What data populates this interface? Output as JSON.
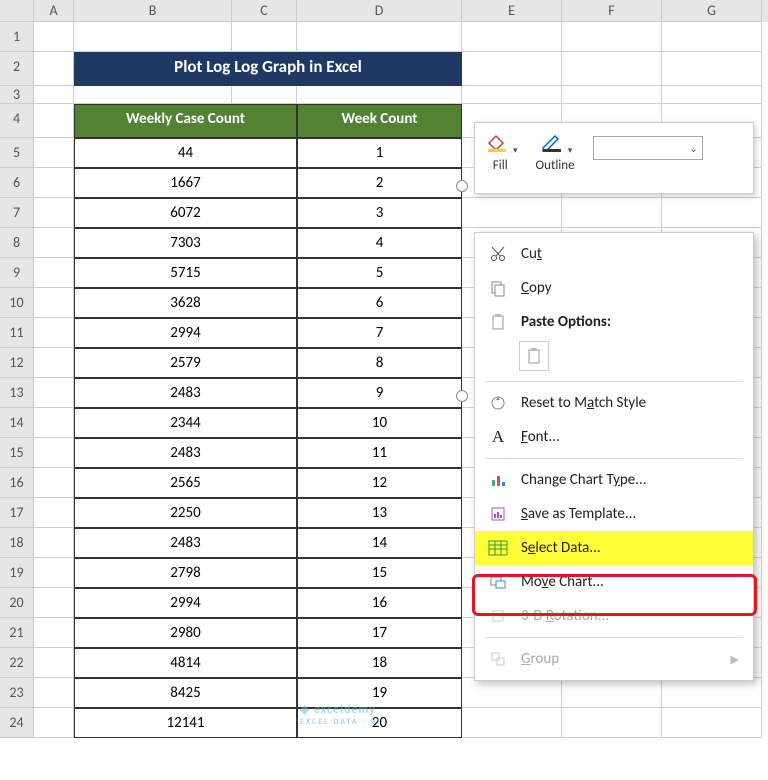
{
  "cols": [
    "A",
    "B",
    "C",
    "D",
    "E",
    "F",
    "G"
  ],
  "title": "Plot Log Log Graph in Excel",
  "headers": {
    "b": "Weekly Case Count",
    "d": "Week Count"
  },
  "rows": [
    {
      "b": "44",
      "d": "1"
    },
    {
      "b": "1667",
      "d": "2"
    },
    {
      "b": "6072",
      "d": "3"
    },
    {
      "b": "7303",
      "d": "4"
    },
    {
      "b": "5715",
      "d": "5"
    },
    {
      "b": "3628",
      "d": "6"
    },
    {
      "b": "2994",
      "d": "7"
    },
    {
      "b": "2579",
      "d": "8"
    },
    {
      "b": "2483",
      "d": "9"
    },
    {
      "b": "2344",
      "d": "10"
    },
    {
      "b": "2483",
      "d": "11"
    },
    {
      "b": "2565",
      "d": "12"
    },
    {
      "b": "2250",
      "d": "13"
    },
    {
      "b": "2483",
      "d": "14"
    },
    {
      "b": "2798",
      "d": "15"
    },
    {
      "b": "2994",
      "d": "16"
    },
    {
      "b": "2980",
      "d": "17"
    },
    {
      "b": "4814",
      "d": "18"
    },
    {
      "b": "8425",
      "d": "19"
    },
    {
      "b": "12141",
      "d": "20"
    }
  ],
  "toolbar": {
    "fill": "Fill",
    "outline": "Outline"
  },
  "menu": {
    "cut": "Cut",
    "copy": "Copy",
    "pastehdr": "Paste Options:",
    "reset": "Reset to Match Style",
    "font": "Font...",
    "cct": "Change Chart Type...",
    "sat": "Save as Template...",
    "select": "Select Data...",
    "move": "Move Chart...",
    "rot": "3-D Rotation...",
    "group": "Group"
  },
  "wm": "exceldemy",
  "wms": "EXCEL DATA - BI"
}
